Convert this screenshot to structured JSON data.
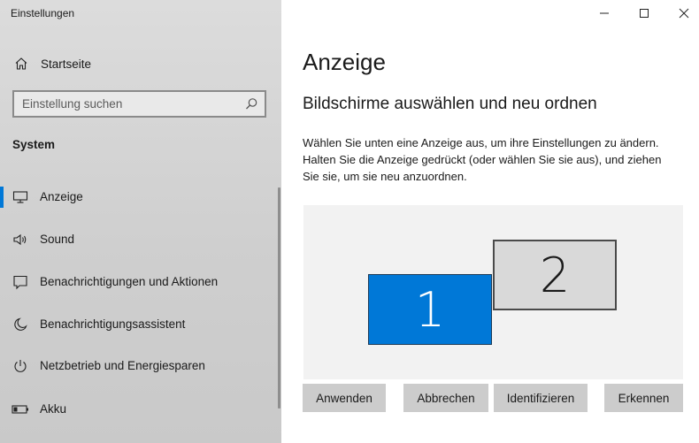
{
  "app": {
    "title": "Einstellungen"
  },
  "sidebar": {
    "home_label": "Startseite",
    "search_placeholder": "Einstellung suchen",
    "section_title": "System",
    "items": [
      {
        "label": "Anzeige",
        "icon": "monitor-icon"
      },
      {
        "label": "Sound",
        "icon": "speaker-icon"
      },
      {
        "label": "Benachrichtigungen und Aktionen",
        "icon": "notification-icon"
      },
      {
        "label": "Benachrichtigungsassistent",
        "icon": "moon-icon"
      },
      {
        "label": "Netzbetrieb und Energiesparen",
        "icon": "power-icon"
      },
      {
        "label": "Akku",
        "icon": "battery-icon"
      }
    ]
  },
  "main": {
    "title": "Anzeige",
    "subtitle": "Bildschirme auswählen und neu ordnen",
    "description_lines": [
      "Wählen Sie unten eine Anzeige aus, um ihre Einstellungen zu ändern.",
      "Halten Sie die Anzeige gedrückt (oder wählen Sie sie aus), und ziehen",
      "Sie sie, um sie neu anzuordnen."
    ],
    "monitors": [
      {
        "label": "1",
        "selected": true
      },
      {
        "label": "2",
        "selected": false
      }
    ],
    "buttons": {
      "apply": "Anwenden",
      "cancel": "Abbrechen",
      "identify": "Identifizieren",
      "detect": "Erkennen"
    }
  },
  "colors": {
    "accent": "#0078d7",
    "sidebar_bg": "#d6d6d6",
    "button_bg": "#cccccc"
  }
}
